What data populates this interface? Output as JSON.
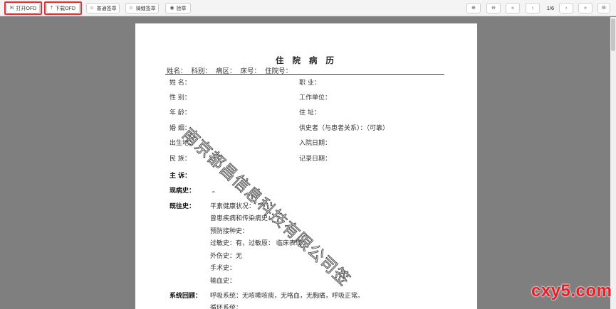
{
  "toolbar": {
    "open_ofd": "打开OFD",
    "download_ofd": "下载OFD",
    "normal_sign": "普通签章",
    "seam_sign": "骑缝签章",
    "verify": "验章",
    "page_indicator": "1/6",
    "icons": {
      "open": "mail-icon",
      "download": "upload-icon",
      "normal_sign": "user-icon",
      "seam_sign": "user-icon",
      "verify": "eye-icon",
      "zoom_in": "zoom-in-icon",
      "zoom_out": "zoom-out-icon",
      "first": "first-page-icon",
      "prev": "prev-page-icon",
      "next": "next-page-icon",
      "last": "last-page-icon",
      "settings": "gear-icon"
    },
    "highlight_color": "#e03232"
  },
  "document": {
    "title": "住 院 病 历",
    "patient_line": "姓名： 科别： 病区： 床号： 住院号：",
    "fields_left": [
      "姓 名：",
      "性 别：",
      "年 龄：",
      "婚 姻：",
      "出生地：",
      "民 族："
    ],
    "fields_right": [
      "职 业：",
      "工作单位：",
      "住 址：",
      "供史者（与患者关系）：（可靠）",
      "入院日期：",
      "记录日期："
    ],
    "chief_complaint_label": "主 诉：",
    "present_illness_label": "现病史：",
    "present_illness_value": "。",
    "past_history_label": "既往史：",
    "past_history_items": [
      "平素健康状况：",
      "曾患疾病和传染病史：",
      "预防接种史：",
      "过敏史：有，过敏原：  临床表现：",
      "外伤史：无",
      "手术史：",
      "输血史："
    ],
    "review_label": "系统回顾：",
    "review_items": [
      "呼吸系统：无咳嗽咳痰，无咯血，无胸痛，呼吸正常。",
      "循环系统："
    ]
  },
  "watermark": "南京都昌信息科技有限公司签",
  "site_logo": "cxy5.com"
}
